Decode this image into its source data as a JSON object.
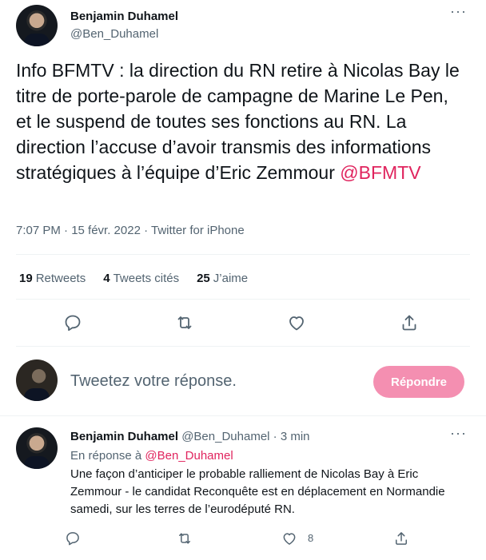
{
  "main_tweet": {
    "author_name": "Benjamin Duhamel",
    "author_handle": "@Ben_Duhamel",
    "more": "···",
    "text_before_mention": "Info BFMTV : la direction du RN retire à Nicolas Bay le titre de porte-parole de campagne de Marine Le Pen, et le suspend de toutes ses fonctions au RN. La direction l’accuse d’avoir transmis des informations stratégiques à l’équipe d’Eric Zemmour ",
    "mention": "@BFMTV",
    "meta": "7:07 PM · 15 févr. 2022 · Twitter for iPhone",
    "stats": {
      "retweets_count": "19",
      "retweets_label": "Retweets",
      "quotes_count": "4",
      "quotes_label": "Tweets cités",
      "likes_count": "25",
      "likes_label": "J’aime"
    },
    "actions": [
      "reply-icon",
      "retweet-icon",
      "like-icon",
      "share-icon"
    ]
  },
  "composer": {
    "placeholder": "Tweetez votre réponse.",
    "button_label": "Répondre"
  },
  "reply_tweet": {
    "author_name": "Benjamin Duhamel",
    "author_handle": "@Ben_Duhamel",
    "time": " · 3 min",
    "more": "···",
    "in_reply_prefix": "En réponse à ",
    "in_reply_mention": "@Ben_Duhamel",
    "text": "Une façon d’anticiper le probable ralliement de Nicolas Bay à Eric Zemmour - le candidat Reconquête est en déplacement en Normandie samedi, sur les terres de l’eurodéputé RN.",
    "like_count": "8"
  },
  "colors": {
    "accent_pink": "#e0245e",
    "button_pink": "#f48fb1",
    "secondary_text": "#536471"
  }
}
